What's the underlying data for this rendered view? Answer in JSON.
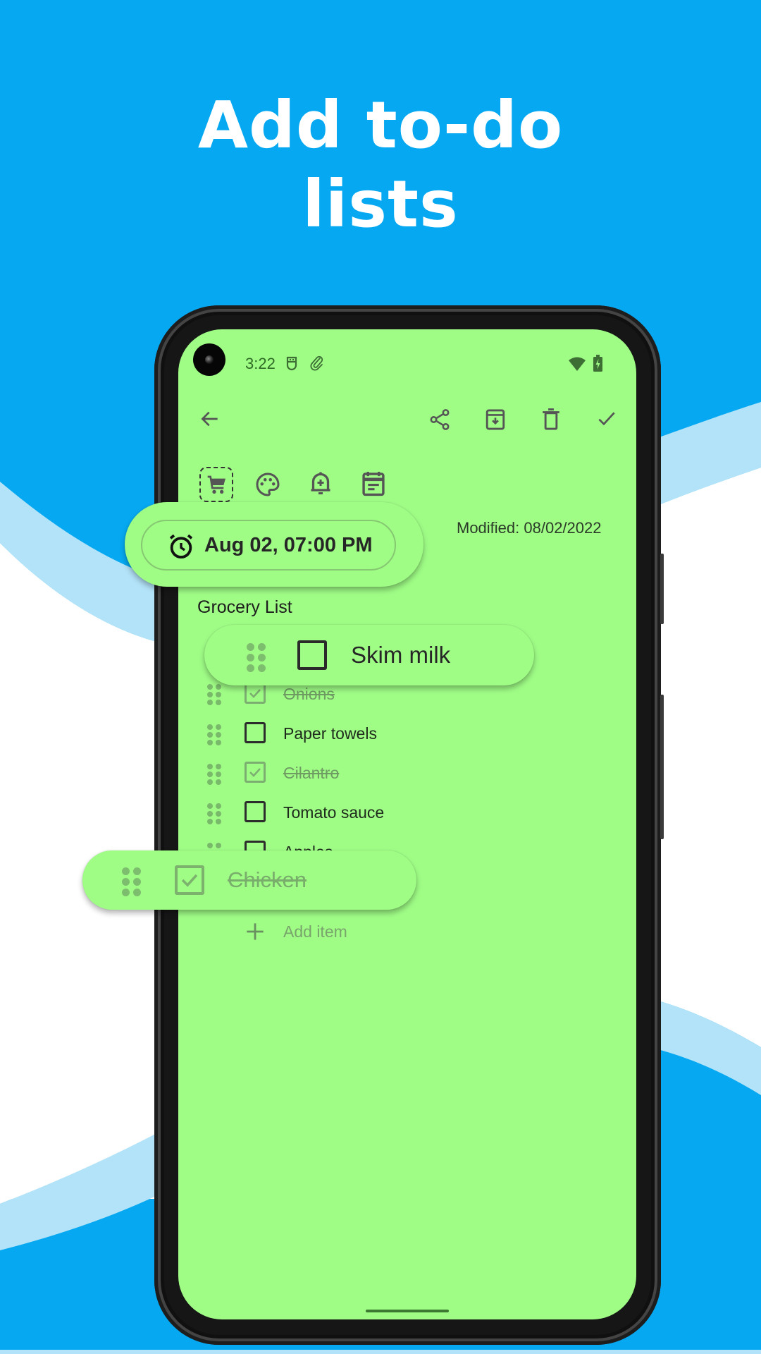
{
  "headline": {
    "line1": "Add to-do",
    "line2": "lists"
  },
  "colors": {
    "background_blue": "#05a8f1",
    "wave_light_blue": "#b3e3f8",
    "note_green": "#9ffd86",
    "icon_gray": "#555555"
  },
  "status_bar": {
    "time": "3:22",
    "icons": [
      "notification-icon",
      "attachment-icon",
      "wifi-icon",
      "battery-charging-icon"
    ]
  },
  "toolbar": {
    "back": "back-arrow-icon",
    "actions": [
      "share-icon",
      "archive-icon",
      "delete-icon",
      "check-icon"
    ]
  },
  "note_options": [
    "shopping-cart-icon",
    "palette-icon",
    "add-reminder-icon",
    "calendar-icon"
  ],
  "reminder": {
    "label": "Aug 02, 07:00 PM"
  },
  "modified": "Modified: 08/02/2022",
  "note_title": "Grocery List",
  "checklist": {
    "floating_top": {
      "text": "Skim milk",
      "checked": false
    },
    "items": [
      {
        "text": "Onions",
        "checked": true
      },
      {
        "text": "Paper towels",
        "checked": false
      },
      {
        "text": "Cilantro",
        "checked": true
      },
      {
        "text": "Tomato sauce",
        "checked": false
      },
      {
        "text": "Apples",
        "checked": false
      }
    ],
    "floating_bottom": {
      "text": "Chicken",
      "checked": true
    },
    "add_item": "Add item"
  }
}
